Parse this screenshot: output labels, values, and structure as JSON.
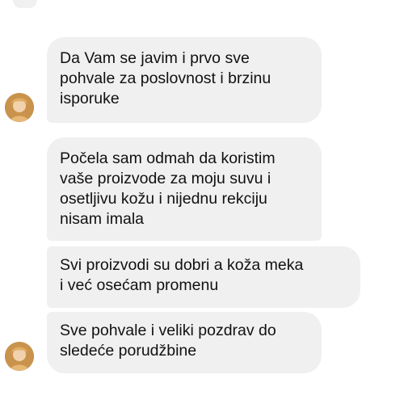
{
  "colors": {
    "bubble_bg": "#f0f0f0",
    "text": "#111111",
    "background": "#ffffff"
  },
  "messages": [
    {
      "text": "Da Vam se javim i prvo sve\npohvale za poslovnost i brzinu\nisporuke"
    },
    {
      "text": "Počela sam odmah da koristim\nvaše proizvode za moju suvu i\nosetljivu kožu i nijednu rekciju\nnisam imala"
    },
    {
      "text": "Svi proizvodi su dobri a koža meka\ni već osećam promenu"
    },
    {
      "text": "Sve pohvale i veliki pozdrav do\nsledeće porudžbine"
    }
  ],
  "avatar_icon": "user-avatar-icon"
}
